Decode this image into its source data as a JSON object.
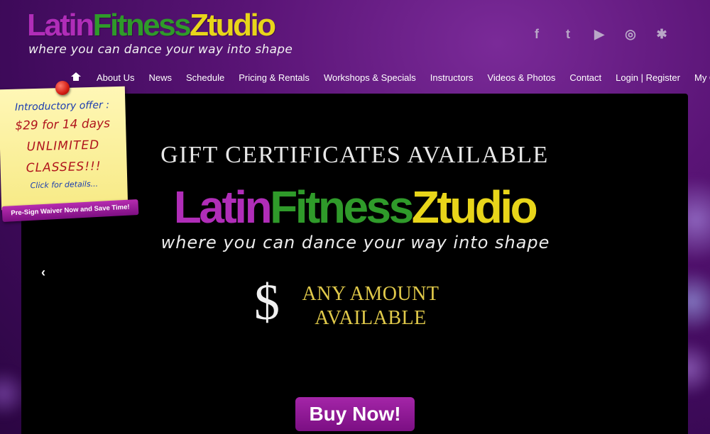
{
  "brand": {
    "logo_part1": "Latin",
    "logo_part2": "Fitness",
    "logo_part3": "Ztudio",
    "tagline": "where you can dance your way into shape"
  },
  "social": [
    {
      "name": "facebook-icon",
      "glyph": "f"
    },
    {
      "name": "twitter-icon",
      "glyph": "t"
    },
    {
      "name": "youtube-icon",
      "glyph": "▶"
    },
    {
      "name": "instagram-icon",
      "glyph": "◎"
    },
    {
      "name": "yelp-icon",
      "glyph": "✱"
    }
  ],
  "nav": {
    "items": [
      "About Us",
      "News",
      "Schedule",
      "Pricing & Rentals",
      "Workshops & Specials",
      "Instructors",
      "Videos & Photos",
      "Contact",
      "Login | Register",
      "My Cart"
    ]
  },
  "promo": {
    "line1": "Introductory offer :",
    "line2": "$29 for 14 days",
    "line3": "UNLIMITED",
    "line4": "CLASSES!!!",
    "line5": "Click for details...",
    "waiver": "Pre-Sign Waiver Now and Save Time!"
  },
  "slide": {
    "title": "GIFT CERTIFICATES AVAILABLE",
    "dollar": "$",
    "amount_line1": "ANY AMOUNT",
    "amount_line2": "AVAILABLE",
    "prev_arrow": "‹",
    "buy_label": "Buy Now!"
  },
  "colors": {
    "background": "#5a1476",
    "logo_purple": "#b02db8",
    "logo_green": "#2f9a2a",
    "logo_yellow": "#e8d51a",
    "button": "#9a1fa0",
    "amount_gold": "#e0c94a"
  }
}
